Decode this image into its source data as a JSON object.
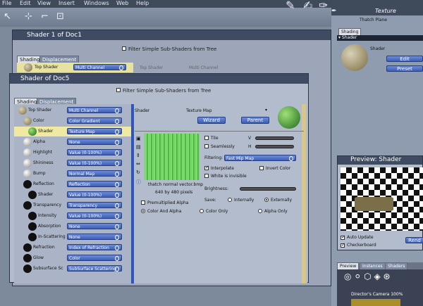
{
  "menu": [
    "File",
    "Edit",
    "View",
    "Insert",
    "Windows",
    "Web",
    "Help"
  ],
  "mode_label": "Texture",
  "right": {
    "title": "Thatch Plane",
    "tab": "Shading",
    "section": "Shader",
    "shader_label": "Shader",
    "edit": "Edit",
    "preset": "Preset",
    "preview_title": "Preview: Shader",
    "auto_update": "Auto Update",
    "checkerboard": "Checkerboard",
    "rend": "Rend",
    "tabs": [
      "Preview",
      "Instances",
      "Shaders"
    ],
    "camera": "Director's Camera 100%"
  },
  "back_window": {
    "title": "Shader 1 of Doc1",
    "filter": "Filter Simple Sub-Shaders from Tree",
    "tabs": [
      "Shading",
      "Displacement"
    ],
    "row_label": "Top Shader",
    "row_value": "Multi Channel",
    "col_a": "Top Shader",
    "col_b": "Multi Channel"
  },
  "window": {
    "title": "Shader of Doc5",
    "filter": "Filter Simple Sub-Shaders from Tree",
    "tabs": [
      "Shading",
      "Displacement"
    ]
  },
  "tree": [
    {
      "label": "Top Shader",
      "value": "Multi Channel"
    },
    {
      "label": "Color",
      "value": "Color Gradient"
    },
    {
      "label": "Shader",
      "value": "Texture Map"
    },
    {
      "label": "Alpha",
      "value": "None"
    },
    {
      "label": "Highlight",
      "value": "Value (0-100%)"
    },
    {
      "label": "Shininess",
      "value": "Value (0-100%)"
    },
    {
      "label": "Bump",
      "value": "Normal Map"
    },
    {
      "label": "Reflection",
      "value": "Reflection"
    },
    {
      "label": "Shader",
      "value": "Value (0-100%)"
    },
    {
      "label": "Transparency",
      "value": "Transparency"
    },
    {
      "label": "Intensity",
      "value": "Value (0-100%)"
    },
    {
      "label": "Absorption",
      "value": "None"
    },
    {
      "label": "In-Scattering",
      "value": "None"
    },
    {
      "label": "Refraction",
      "value": "Index of Refraction"
    },
    {
      "label": "Glow",
      "value": "Color"
    },
    {
      "label": "Subsurface Sc",
      "value": "SubSurface Scattering"
    }
  ],
  "detail": {
    "shader_label": "Shader",
    "type": "Texture Map",
    "wizard": "Wizard",
    "parent": "Parent",
    "tile": "Tile",
    "seamlessly": "Seamlessly",
    "v": "V",
    "h": "H",
    "filtering_label": "Filtering:",
    "filtering_value": "Fast Mip Map",
    "interpolate": "Interpolate",
    "invert_color": "Invert Color",
    "white_invisible": "White is invisible",
    "brightness": "Brightness:",
    "save": "Save:",
    "internally": "Internally",
    "externally": "Externally",
    "filename": "thatch normal vector.bmp",
    "dims": "640 by 480 pixels",
    "premultiplied": "Premultiplied Alpha",
    "color_and_alpha": "Color And Alpha",
    "color_only": "Color Only",
    "alpha_only": "Alpha Only"
  }
}
